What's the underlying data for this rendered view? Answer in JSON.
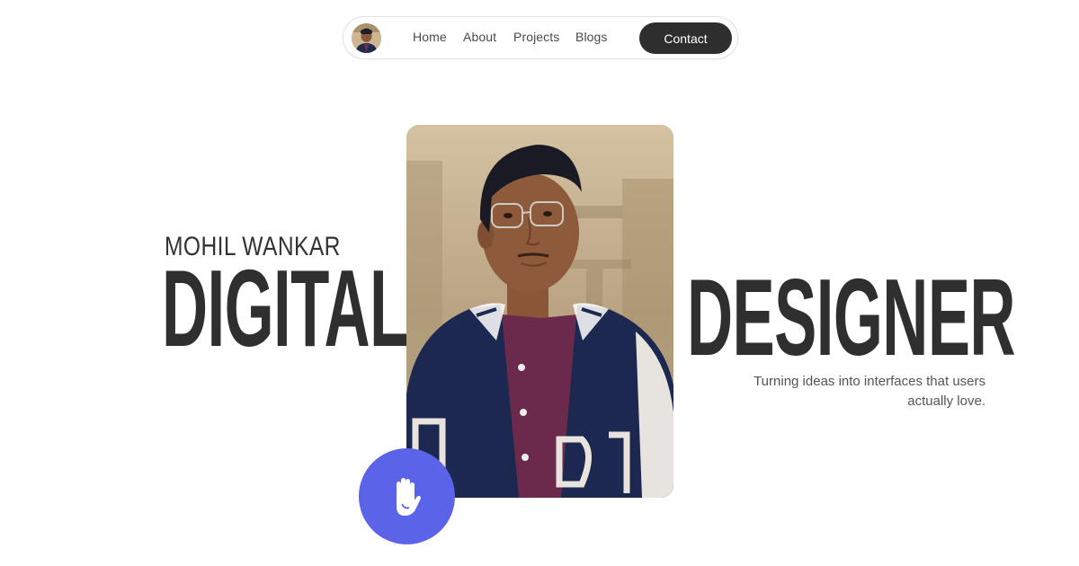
{
  "nav": {
    "avatar_icon": "profile-avatar",
    "links": [
      "Home",
      "About",
      "Projects",
      "Blogs"
    ],
    "contact_label": "Contact"
  },
  "hero": {
    "name": "MOHIL WANKAR",
    "title_left": "DIGITAL",
    "title_right": "DESIGNER",
    "tagline_line1": "Turning ideas into interfaces that users",
    "tagline_line2": "actually love."
  },
  "wave_button": {
    "icon": "waving-hand-icon",
    "color": "#5b63e8"
  },
  "colors": {
    "text_dark": "#2f2f2f",
    "button_dark": "#2e2e2e",
    "accent": "#5b63e8"
  }
}
